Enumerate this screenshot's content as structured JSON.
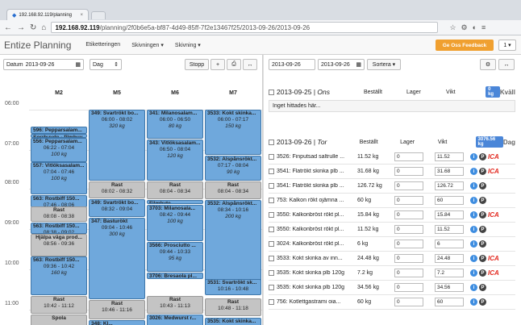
{
  "browser": {
    "tab_title": "192.168.92.119/planning",
    "url_host": "192.168.92.119",
    "url_path": "/planning/2f0b6e5a-bf87-4d49-85ff-7f2e13467f25/2013-09-26/2013-09-26"
  },
  "header": {
    "brand": "Entize Planning",
    "menu": [
      "Etiketteringen",
      "Skivningen ▾",
      "Skivning ▾"
    ],
    "feedback": "Ge Oss Feedback",
    "user": "1 ▾"
  },
  "left": {
    "date_label": "Datum",
    "date_value": "2013-09-26",
    "view_value": "Dag",
    "stop_label": "Stopp",
    "columns": [
      "M2",
      "M5",
      "M6",
      "M7"
    ],
    "times": [
      "06:00",
      "07:00",
      "08:00",
      "09:00",
      "10:00",
      "11:00"
    ],
    "events": [
      [
        {
          "t": "596: Pepparsalam...",
          "l2": "",
          "l3": "",
          "s": 21,
          "h": 9,
          "rest": false
        },
        {
          "t": "Sorrhuvde - filmhuv",
          "l2": "",
          "l3": "",
          "s": 30,
          "h": 5,
          "rest": false
        },
        {
          "t": "556: Pepparsalam...",
          "l2": "06:22 - 07:04",
          "l3": "100 kg",
          "s": 35,
          "h": 30,
          "rest": false
        },
        {
          "t": "557: Vitlöksasalam...",
          "l2": "07:04 - 07:46",
          "l3": "100 kg",
          "s": 65,
          "h": 40,
          "rest": false
        },
        {
          "t": "563: Rostbiff 150...",
          "l2": "07:46 - 08:06",
          "l3": "",
          "s": 106,
          "h": 15,
          "rest": false
        },
        {
          "t": "Rast",
          "l2": "08:08 - 08:38",
          "l3": "",
          "s": 120,
          "h": 19,
          "rest": true
        },
        {
          "t": "563: Rostbiff 150...",
          "l2": "08:38 - 09:02",
          "l3": "",
          "s": 140,
          "h": 14,
          "rest": false
        },
        {
          "t": "Hjälpa väga prod...",
          "l2": "08:56 - 09:36",
          "l3": "",
          "s": 154,
          "h": 28,
          "rest": true
        },
        {
          "t": "563: Rostbiff 150...",
          "l2": "09:36 - 10:42",
          "l3": "160 kg",
          "s": 182,
          "h": 48,
          "rest": false
        },
        {
          "t": "Rast",
          "l2": "10:42 - 11:12",
          "l3": "",
          "s": 231,
          "h": 22,
          "rest": true
        },
        {
          "t": "Spola",
          "l2": "",
          "l3": "",
          "s": 254,
          "h": 16,
          "rest": true
        }
      ],
      [
        {
          "t": "349: Svartrökt bo...",
          "l2": "06:00 - 08:02",
          "l3": "320 kg",
          "s": 0,
          "h": 88,
          "rest": false
        },
        {
          "t": "Rast",
          "l2": "08:02 - 08:32",
          "l3": "",
          "s": 89,
          "h": 21,
          "rest": true
        },
        {
          "t": "349: Svartrökt bo...",
          "l2": "08:32 - 09:04",
          "l3": "",
          "s": 111,
          "h": 22,
          "rest": false
        },
        {
          "t": "347: Basturökt",
          "l2": "09:04 - 10:46",
          "l3": "300 kg",
          "s": 134,
          "h": 101,
          "rest": false
        },
        {
          "t": "Rast",
          "l2": "10:46 - 11:16",
          "l3": "",
          "s": 236,
          "h": 24,
          "rest": true
        },
        {
          "t": "348: Kl...",
          "l2": "",
          "l3": "",
          "s": 261,
          "h": 12,
          "rest": false
        }
      ],
      [
        {
          "t": "341: Milanosalam...",
          "l2": "06:00 - 06:50",
          "l3": "80 kg",
          "s": 0,
          "h": 36,
          "rest": false
        },
        {
          "t": "343: Vitlöksasalam...",
          "l2": "06:50 - 08:04",
          "l3": "120 kg",
          "s": 37,
          "h": 51,
          "rest": false
        },
        {
          "t": "Rast",
          "l2": "08:04 - 08:34",
          "l3": "",
          "s": 89,
          "h": 22,
          "rest": true
        },
        {
          "t": "Filmbyte",
          "l2": "",
          "l3": "",
          "s": 112,
          "h": 5,
          "rest": false
        },
        {
          "t": "3703: Milanosala...",
          "l2": "08:42 - 09:44",
          "l3": "100 kg",
          "s": 118,
          "h": 45,
          "rest": false
        },
        {
          "t": "3566: Prosciutto ...",
          "l2": "09:44 - 10:33",
          "l3": "95 kg",
          "s": 164,
          "h": 37,
          "rest": false
        },
        {
          "t": "3706: Bresaola pl...",
          "l2": "",
          "l3": "",
          "s": 202,
          "h": 8,
          "rest": false
        },
        {
          "t": "Rast",
          "l2": "10:43 - 11:13",
          "l3": "",
          "s": 231,
          "h": 22,
          "rest": true
        },
        {
          "t": "3026: Medwurst r...",
          "l2": "",
          "l3": "",
          "s": 254,
          "h": 16,
          "rest": false
        }
      ],
      [
        {
          "t": "3533: Kokt skinka...",
          "l2": "06:00 - 07:17",
          "l3": "150 kg",
          "s": 0,
          "h": 56,
          "rest": false
        },
        {
          "t": "3532: Alspånsrökt...",
          "l2": "07:17 - 08:04",
          "l3": "90 kg",
          "s": 57,
          "h": 31,
          "rest": false
        },
        {
          "t": "Rast",
          "l2": "08:04 - 08:34",
          "l3": "",
          "s": 89,
          "h": 22,
          "rest": true
        },
        {
          "t": "3532: Alspånsrökt...",
          "l2": "08:34 - 10:16",
          "l3": "200 kg",
          "s": 112,
          "h": 108,
          "rest": false
        },
        {
          "t": "3531: Svartrökt sk...",
          "l2": "10:16 - 10:48",
          "l3": "",
          "s": 210,
          "h": 20,
          "rest": false
        },
        {
          "t": "Rast",
          "l2": "10:48 - 11:18",
          "l3": "",
          "s": 234,
          "h": 22,
          "rest": true
        },
        {
          "t": "3535: Kokt skinka...",
          "l2": "",
          "l3": "",
          "s": 258,
          "h": 12,
          "rest": false
        }
      ]
    ]
  },
  "right": {
    "date_from": "2013-09-26",
    "date_to": "2013-09-26",
    "sort_label": "Sortera ▾",
    "day1": {
      "date": "2013-09-25",
      "dow": "Ons",
      "h1": "Beställt",
      "h2": "Lager",
      "h3": "Vikt",
      "badge": "0 kg",
      "shift": "Kväll",
      "empty": "Inget hittades här..."
    },
    "day2": {
      "date": "2013-09-26",
      "dow": "Tor",
      "h1": "Beställt",
      "h2": "Lager",
      "h3": "Vikt",
      "badge": "3076.56 kg",
      "shift": "Dag"
    },
    "rows": [
      {
        "name": "3526: Finputsad saltrulle ...",
        "ordered": "11.52 kg",
        "stock": "0",
        "weight": "11.52",
        "ica": true
      },
      {
        "name": "3541: Flatrökt skinka plb ...",
        "ordered": "31.68 kg",
        "stock": "0",
        "weight": "31.68",
        "ica": true
      },
      {
        "name": "3541: Flatrökt skinka plb ...",
        "ordered": "126.72 kg",
        "stock": "0",
        "weight": "126.72",
        "ica": false
      },
      {
        "name": "753: Kalkon rökt ojämna ...",
        "ordered": "60 kg",
        "stock": "0",
        "weight": "60",
        "ica": false
      },
      {
        "name": "3550: Kalkonbröst rökt pl...",
        "ordered": "15.84 kg",
        "stock": "0",
        "weight": "15.84",
        "ica": true
      },
      {
        "name": "3550: Kalkonbröst rökt pl...",
        "ordered": "11.52 kg",
        "stock": "0",
        "weight": "11.52",
        "ica": false
      },
      {
        "name": "3024: Kalkonbröst rökt pl...",
        "ordered": "6 kg",
        "stock": "0",
        "weight": "6",
        "ica": false
      },
      {
        "name": "3533: Kokt skinka av inn...",
        "ordered": "24.48 kg",
        "stock": "0",
        "weight": "24.48",
        "ica": true
      },
      {
        "name": "3535: Kokt skinka plb 120g",
        "ordered": "7.2 kg",
        "stock": "0",
        "weight": "7.2",
        "ica": true
      },
      {
        "name": "3535: Kokt skinka plb 120g",
        "ordered": "34.56 kg",
        "stock": "0",
        "weight": "34.56",
        "ica": false
      },
      {
        "name": "756: Kotlettgastrami oia...",
        "ordered": "60 kg",
        "stock": "0",
        "weight": "60",
        "ica": false
      }
    ]
  }
}
